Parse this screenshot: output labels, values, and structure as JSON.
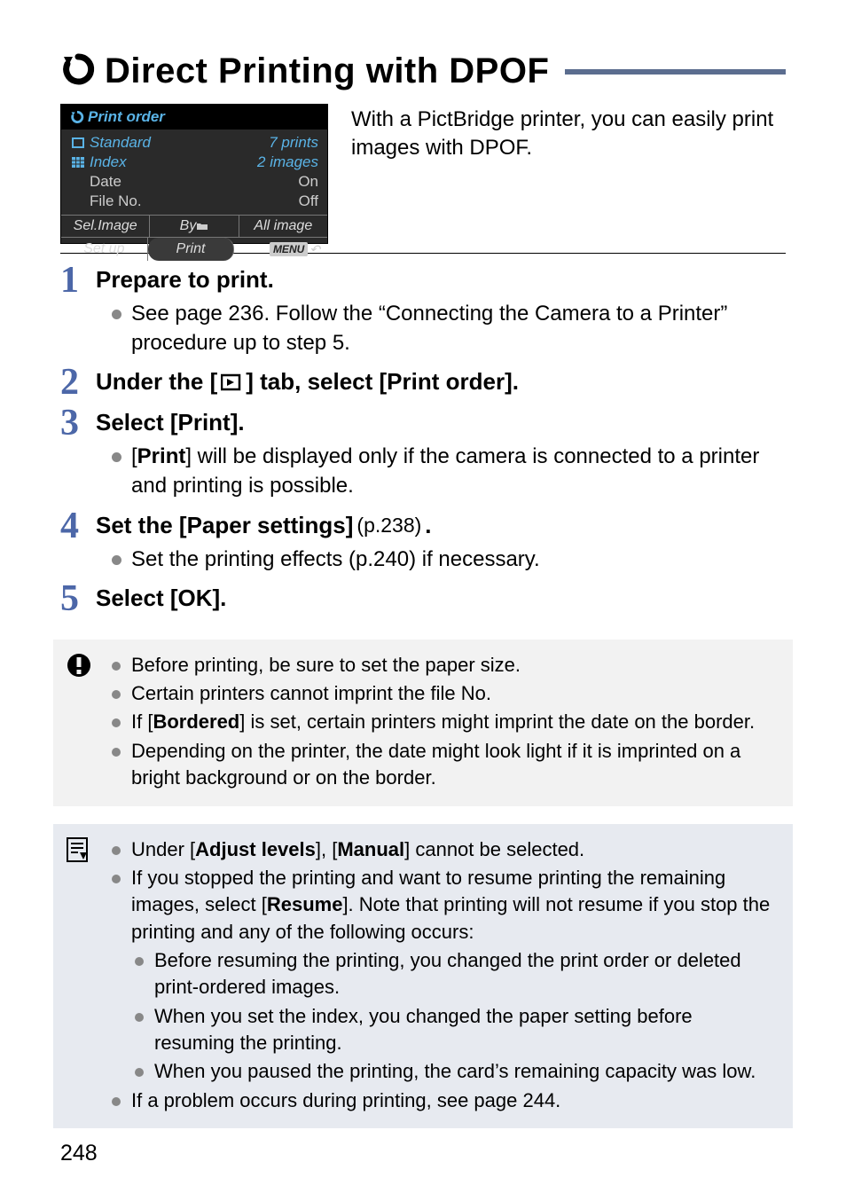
{
  "heading": {
    "title": "Direct Printing with DPOF"
  },
  "camscreen": {
    "title": "Print order",
    "rows": [
      {
        "label": "Standard",
        "value": "7 prints",
        "cyan": true,
        "icon": "square"
      },
      {
        "label": "Index",
        "value": "2 images",
        "cyan": true,
        "icon": "grid"
      },
      {
        "label": "Date",
        "value": "On",
        "cyan": false
      },
      {
        "label": "File No.",
        "value": "Off",
        "cyan": false
      }
    ],
    "tabs": [
      "Sel.Image",
      "By",
      "All image"
    ],
    "footer": {
      "left": "Set up",
      "mid": "Print",
      "menu": "MENU"
    }
  },
  "intro": "With a PictBridge printer, you can easily print images with DPOF.",
  "steps": {
    "s1": {
      "title": "Prepare to print.",
      "bullets": [
        "See page 236. Follow the “Connecting the Camera to a Printer” procedure up to step 5."
      ]
    },
    "s2": {
      "title_pre": "Under the [",
      "title_post": "] tab, select [Print order]."
    },
    "s3": {
      "title": "Select [Print].",
      "bullet_pre": "[",
      "bullet_bold": "Print",
      "bullet_post": "] will be displayed only if the camera is connected to a printer and printing is possible."
    },
    "s4": {
      "title_pre": "Set the [Paper settings] ",
      "paren": "(p.238)",
      "title_post": ".",
      "bullet": "Set the printing effects (p.240) if necessary."
    },
    "s5": {
      "title": "Select [OK]."
    }
  },
  "warn": {
    "b1": "Before printing, be sure to set the paper size.",
    "b2": "Certain printers cannot imprint the file No.",
    "b3_pre": "If [",
    "b3_bold": "Bordered",
    "b3_post": "] is set, certain printers might imprint the date on the border.",
    "b4": "Depending on the printer, the date might look light if it is imprinted on a bright background or on the border."
  },
  "note": {
    "b1_pre": "Under [",
    "b1_bold1": "Adjust levels",
    "b1_mid": "], [",
    "b1_bold2": "Manual",
    "b1_post": "] cannot be selected.",
    "b2_pre": "If you stopped the printing and want to resume printing the remaining images, select [",
    "b2_bold": "Resume",
    "b2_post": "]. Note that printing will not resume if you stop the printing and any of the following occurs:",
    "sub1": "Before resuming the printing, you changed the print order or deleted print-ordered images.",
    "sub2": "When you set the index, you changed the paper setting before resuming the printing.",
    "sub3": "When you paused the printing, the card’s remaining capacity was low.",
    "b3": "If a problem occurs during printing, see page 244."
  },
  "page": "248"
}
